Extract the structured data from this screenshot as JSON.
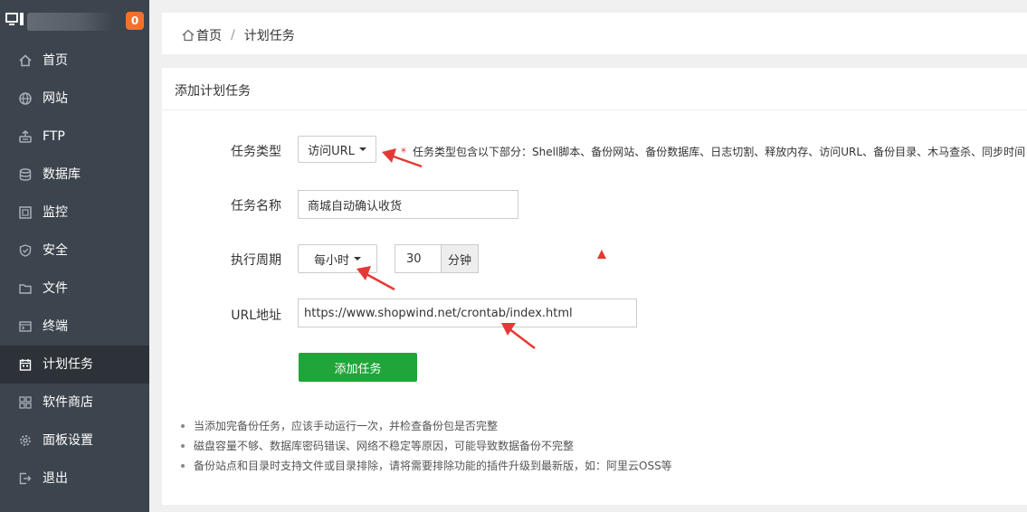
{
  "sidebar": {
    "badge": "0",
    "items": [
      {
        "label": "首页",
        "icon": "home-icon",
        "active": false
      },
      {
        "label": "网站",
        "icon": "globe-icon",
        "active": false
      },
      {
        "label": "FTP",
        "icon": "ftp-icon",
        "active": false
      },
      {
        "label": "数据库",
        "icon": "database-icon",
        "active": false
      },
      {
        "label": "监控",
        "icon": "monitor-icon",
        "active": false
      },
      {
        "label": "安全",
        "icon": "shield-icon",
        "active": false
      },
      {
        "label": "文件",
        "icon": "folder-icon",
        "active": false
      },
      {
        "label": "终端",
        "icon": "terminal-icon",
        "active": false
      },
      {
        "label": "计划任务",
        "icon": "calendar-icon",
        "active": true
      },
      {
        "label": "软件商店",
        "icon": "apps-icon",
        "active": false
      },
      {
        "label": "面板设置",
        "icon": "gear-icon",
        "active": false
      },
      {
        "label": "退出",
        "icon": "logout-icon",
        "active": false
      }
    ]
  },
  "breadcrumb": {
    "home": "首页",
    "separator": "/",
    "current": "计划任务"
  },
  "panel": {
    "title": "添加计划任务"
  },
  "form": {
    "task_type": {
      "label": "任务类型",
      "value": "访问URL"
    },
    "hint": {
      "star": "*",
      "text": "任务类型包含以下部分：Shell脚本、备份网站、备份数据库、日志切割、释放内存、访问URL、备份目录、木马查杀、同步时间"
    },
    "task_name": {
      "label": "任务名称",
      "value": "商城自动确认收货"
    },
    "period": {
      "label": "执行周期",
      "value": "每小时",
      "minutes": "30",
      "unit": "分钟"
    },
    "url": {
      "label": "URL地址",
      "value": "https://www.shopwind.net/crontab/index.html"
    },
    "submit_label": "添加任务"
  },
  "notes": [
    "当添加完备份任务，应该手动运行一次，并检查备份包是否完整",
    "磁盘容量不够、数据库密码错误、网络不稳定等原因，可能导致数据备份不完整",
    "备份站点和目录时支持文件或目录排除，请将需要排除功能的插件升级到最新版，如：阿里云OSS等"
  ],
  "colors": {
    "sidebar_bg": "#3c444d",
    "sidebar_active_bg": "#2c3238",
    "badge": "#f7702b",
    "primary_green": "#20a53a",
    "annotation_red": "#e53935"
  }
}
